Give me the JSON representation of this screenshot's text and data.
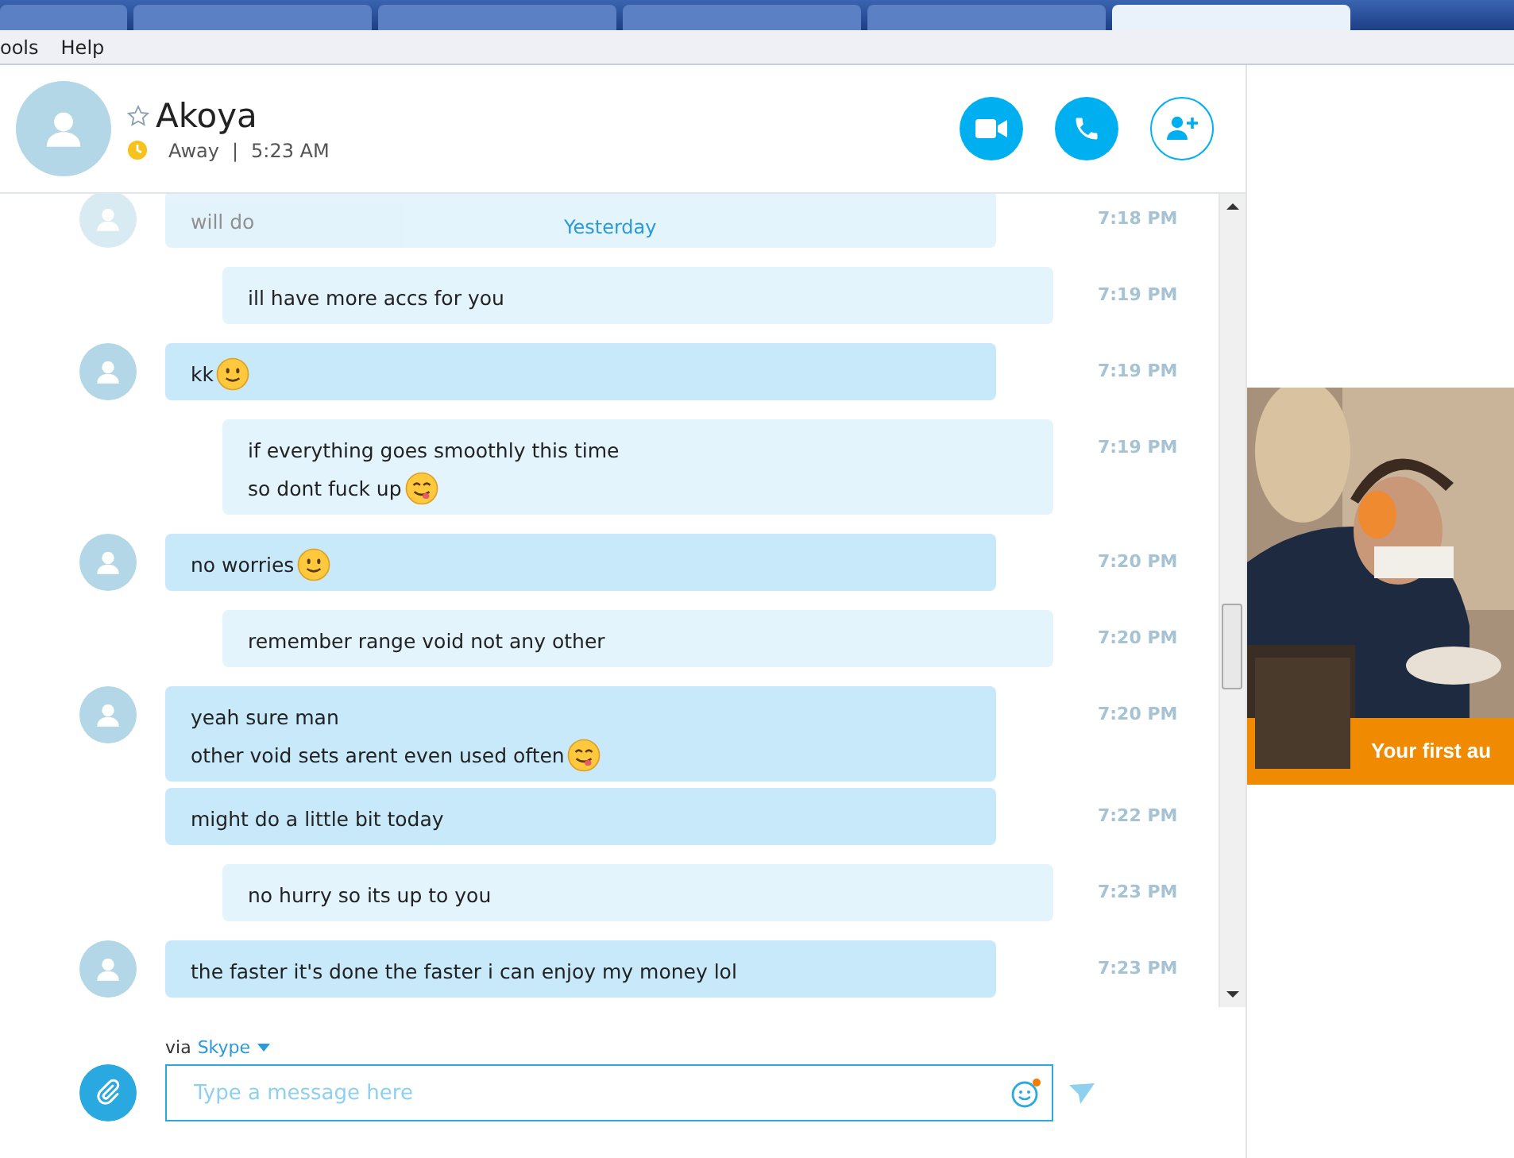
{
  "browser_tabs": [
    {
      "selected": false
    },
    {
      "selected": false
    },
    {
      "selected": false
    },
    {
      "selected": false
    },
    {
      "selected": false
    },
    {
      "selected": true
    }
  ],
  "menu": [
    "ools",
    "Help"
  ],
  "contact": {
    "name": "Akoya",
    "favorite": false,
    "status": "Away",
    "separator": "|",
    "local_time": "5:23 AM"
  },
  "date_divider": "Yesterday",
  "messages": [
    {
      "kind": "incoming",
      "faded": true,
      "lines": [
        {
          "text": "will do"
        }
      ],
      "time": "7:18 PM"
    },
    {
      "kind": "outgoing",
      "faded": false,
      "lines": [
        {
          "text": "ill have more accs for you"
        }
      ],
      "time": "7:19 PM"
    },
    {
      "kind": "incoming",
      "faded": false,
      "lines": [
        {
          "text": "kk",
          "emoji": {
            "kind": "smile"
          }
        }
      ],
      "time": "7:19 PM"
    },
    {
      "kind": "outgoing",
      "faded": false,
      "lines": [
        {
          "text": "if everything goes smoothly this time"
        },
        {
          "text": "so dont fuck up",
          "emoji": {
            "kind": "yum"
          }
        }
      ],
      "time": "7:19 PM"
    },
    {
      "kind": "incoming",
      "faded": false,
      "lines": [
        {
          "text": "no worries",
          "emoji": {
            "kind": "smile"
          }
        }
      ],
      "time": "7:20 PM"
    },
    {
      "kind": "outgoing",
      "faded": false,
      "lines": [
        {
          "text": "remember range void not any other"
        }
      ],
      "time": "7:20 PM"
    },
    {
      "kind": "incoming",
      "faded": false,
      "lines": [
        {
          "text": "yeah sure man"
        },
        {
          "text": "other void sets arent even used often",
          "emoji": {
            "kind": "yum"
          }
        }
      ],
      "time": "7:20 PM"
    },
    {
      "kind": "incoming",
      "faded": false,
      "lines": [
        {
          "text": "might do a little bit today"
        }
      ],
      "time": "7:22 PM"
    },
    {
      "kind": "outgoing",
      "faded": false,
      "lines": [
        {
          "text": "no hurry so its up to you"
        }
      ],
      "time": "7:23 PM"
    },
    {
      "kind": "incoming",
      "faded": false,
      "lines": [
        {
          "text": "the faster it's done the faster i can enjoy my money lol"
        }
      ],
      "time": "7:23 PM"
    }
  ],
  "compose": {
    "via": "via",
    "service": "Skype",
    "placeholder": "Type a message here",
    "emoji_notification": true
  },
  "ad": {
    "kind": "picture",
    "banner": "Your first au"
  }
}
